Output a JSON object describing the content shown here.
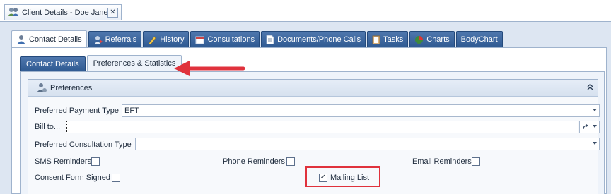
{
  "window": {
    "tab_title": "Client Details - Doe Jane",
    "close_symbol": "✕",
    "tab_icon": "users-icon"
  },
  "main_tabs": [
    {
      "label": "Contact Details",
      "icon": "contact-person-icon",
      "active": true
    },
    {
      "label": "Referrals",
      "icon": "referrals-icon",
      "active": false
    },
    {
      "label": "History",
      "icon": "pencil-icon",
      "active": false
    },
    {
      "label": "Consultations",
      "icon": "calendar-icon",
      "active": false
    },
    {
      "label": "Documents/Phone Calls",
      "icon": "document-icon",
      "active": false
    },
    {
      "label": "Tasks",
      "icon": "clipboard-icon",
      "active": false
    },
    {
      "label": "Charts",
      "icon": "pie-chart-icon",
      "active": false
    },
    {
      "label": "BodyChart",
      "icon": "",
      "active": false
    }
  ],
  "sub_tabs": [
    {
      "label": "Contact Details",
      "active": false
    },
    {
      "label": "Preferences & Statistics",
      "active": true
    }
  ],
  "group": {
    "title": "Preferences",
    "icon": "preferences-person-icon",
    "collapse_symbol": "⌃"
  },
  "form": {
    "payment_type": {
      "label": "Preferred Payment Type",
      "value": "EFT"
    },
    "bill_to": {
      "label": "Bill to...",
      "value": ""
    },
    "consultation_type": {
      "label": "Preferred Consultation Type",
      "value": ""
    },
    "sms_reminders": {
      "label": "SMS Reminders",
      "checked": false
    },
    "phone_reminders": {
      "label": "Phone Reminders",
      "checked": false
    },
    "email_reminders": {
      "label": "Email Reminders",
      "checked": false
    },
    "consent_form": {
      "label": "Consent Form Signed",
      "checked": false
    },
    "mailing_list": {
      "label": "Mailing List",
      "checked": true,
      "check_symbol": "✓"
    }
  },
  "colors": {
    "annotation_red": "#e0323c",
    "tab_blue": "#3a639c"
  }
}
